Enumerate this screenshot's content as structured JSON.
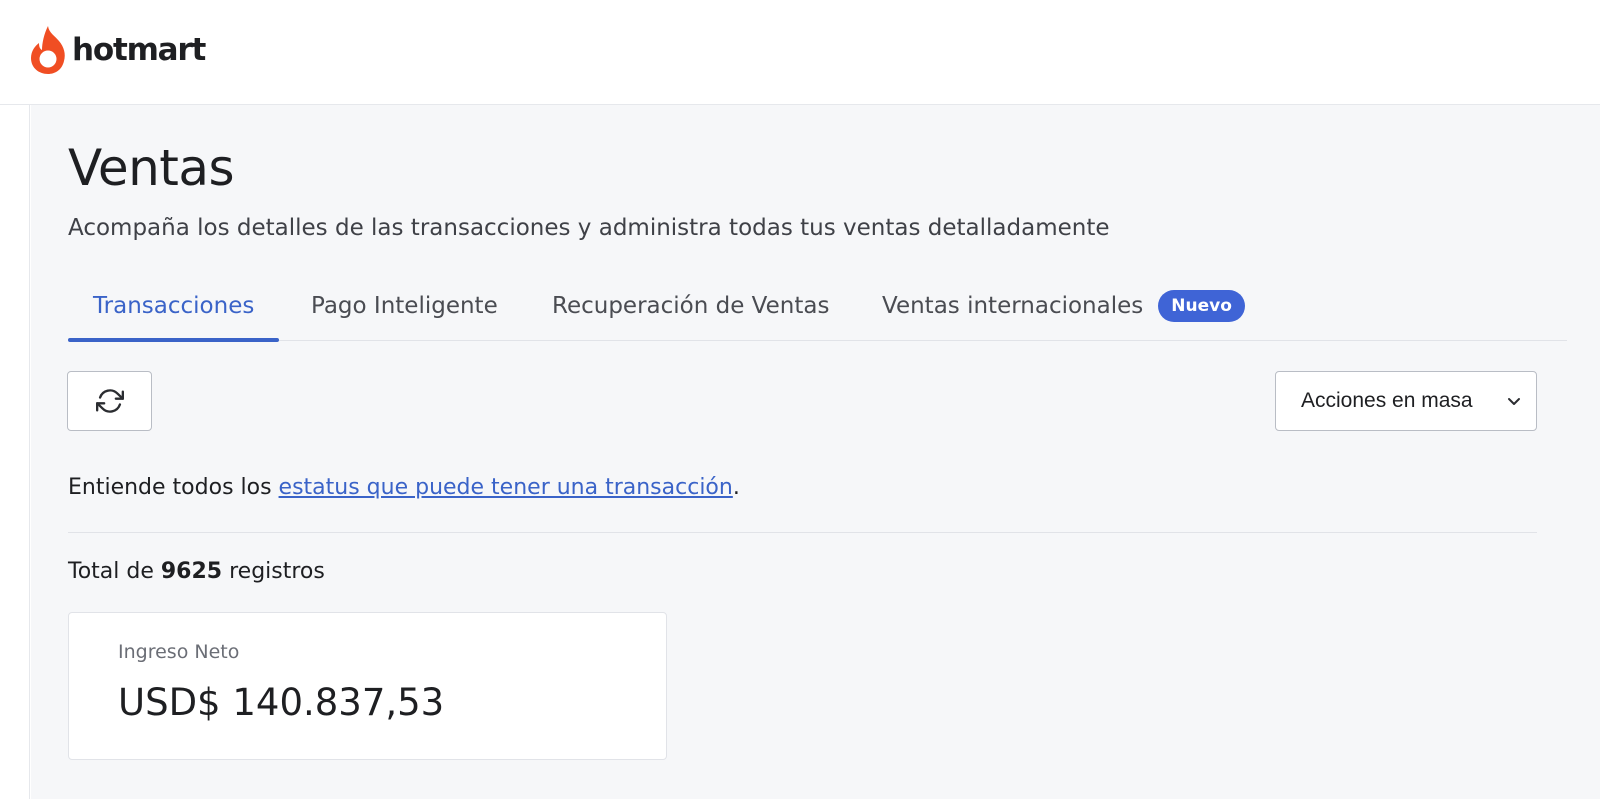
{
  "brand": {
    "name": "hotmart",
    "flame_color": "#f04e23"
  },
  "page": {
    "title": "Ventas",
    "subtitle": "Acompaña los detalles de las transacciones y administra todas tus ventas detalladamente"
  },
  "tabs": [
    {
      "label": "Transacciones",
      "active": true
    },
    {
      "label": "Pago Inteligente",
      "active": false
    },
    {
      "label": "Recuperación de Ventas",
      "active": false
    },
    {
      "label": "Ventas internacionales",
      "active": false,
      "badge": "Nuevo"
    }
  ],
  "toolbar": {
    "refresh_icon": "refresh-icon",
    "bulk_actions_label": "Acciones en masa",
    "bulk_actions_icon": "chevron-down-icon"
  },
  "status_info": {
    "prefix": "Entiende todos los ",
    "link_text": "estatus que puede tener una transacción",
    "suffix": "."
  },
  "totals": {
    "prefix": "Total de ",
    "count": "9625",
    "suffix": " registros"
  },
  "net_income": {
    "label": "Ingreso Neto",
    "value": "USD$ 140.837,53"
  },
  "colors": {
    "accent": "#3a63c8",
    "badge": "#3f64d6",
    "background": "#f6f7f9"
  }
}
